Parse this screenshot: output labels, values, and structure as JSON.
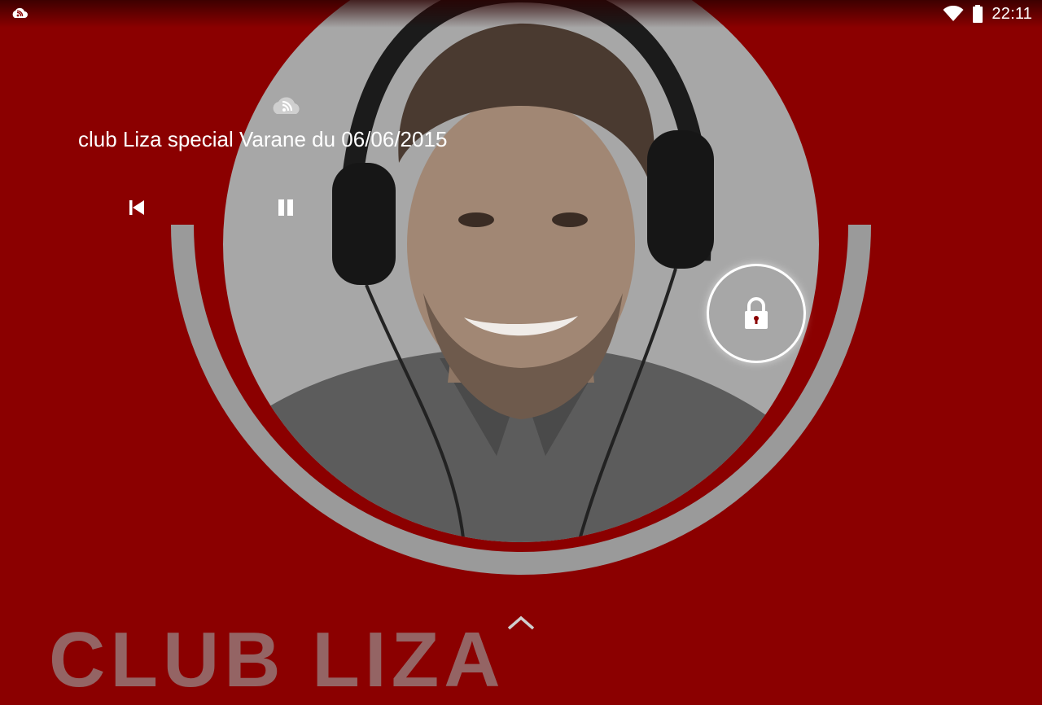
{
  "status_bar": {
    "time": "22:11",
    "left_icon": "podcast-app-icon",
    "right_icons": [
      "wifi-icon",
      "battery-icon"
    ]
  },
  "player": {
    "track_title": "club Liza special Varane du 06/06/2015",
    "source_icon": "podcast-cloud-icon",
    "controls": [
      "previous-track",
      "pause"
    ]
  },
  "lockscreen": {
    "lock_icon": "lock-icon",
    "expand_icon": "chevron-up-icon"
  },
  "brand_text": "CLUB LIZA",
  "colors": {
    "background": "#8b0000",
    "ring": "#9a9a9a",
    "photo_backdrop": "#a7a7a7",
    "icon": "#ffffff"
  }
}
